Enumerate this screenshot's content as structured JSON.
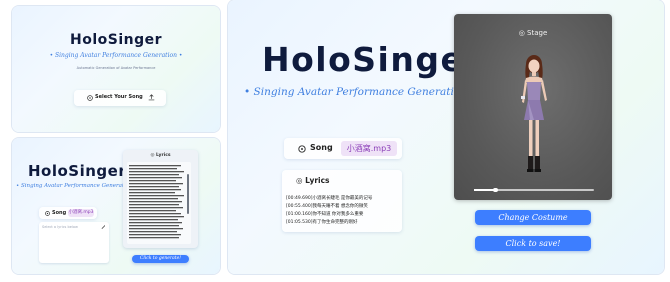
{
  "brand": {
    "title": "HoloSinger",
    "tagline": "Singing Avatar Performance Generation",
    "subtitle": "Automatic Generation of Avatar Performance"
  },
  "panel_a": {
    "select_song_label": "Select Your Song"
  },
  "panel_b": {
    "lyrics_title": "Lyrics",
    "song_label": "Song",
    "song_file": "小酒窝.mp3",
    "lyrics_placeholder": "Select a lyrics below",
    "generate_label": "Click to generate!"
  },
  "panel_c": {
    "stage_title": "Stage",
    "song_label": "Song",
    "song_file": "小酒窝.mp3",
    "lyrics_title": "Lyrics",
    "lyrics": [
      "[00:49.690]小酒窝长睫毛 是你最美的记号",
      "[00:55.400]我每天睡不着 想念你的微笑",
      "[01:00.160]你不知道 你对我多么重要",
      "[01:05.530]有了你生命完整的刚好"
    ],
    "video_progress": 0.18,
    "change_costume_label": "Change Costume",
    "save_label": "Click to save!"
  },
  "colors": {
    "accent": "#3d7eff",
    "brand": "#0f1b3d",
    "tagline": "#3f7fe0",
    "chip_bg": "#efe2f7",
    "chip_text": "#8b3fb8",
    "stage_bg": "#5c5c5c"
  }
}
